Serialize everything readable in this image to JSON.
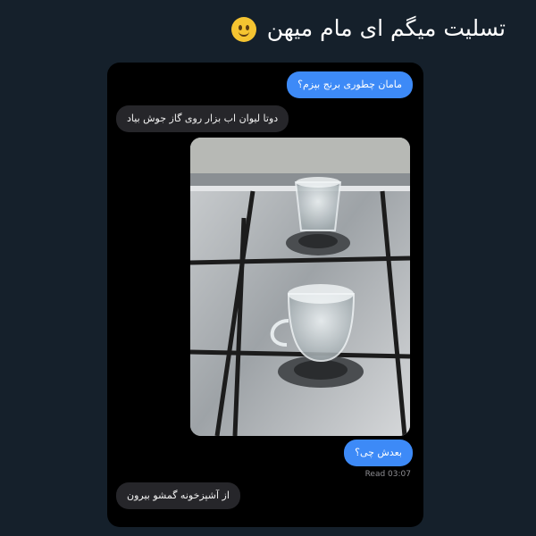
{
  "caption": {
    "text": "تسلیت میگم ای مام میهن",
    "emoji": "slightly-smiling-face-icon"
  },
  "messages": [
    {
      "direction": "outgoing",
      "text": "مامان چطوری برنج بپزم؟"
    },
    {
      "direction": "incoming",
      "text": "دوتا لیوان اب بزار روی گاز جوش بیاد"
    },
    {
      "direction": "incoming",
      "type": "photo",
      "description_icon": "stove-with-glasses-photo"
    },
    {
      "direction": "outgoing",
      "text": "بعدش چی؟"
    },
    {
      "direction": "incoming",
      "text": "از آشپزخونه گمشو بیرون"
    }
  ],
  "receipt": {
    "text": "Read 03:07"
  },
  "colors": {
    "background": "#15202b",
    "chat_bg": "#000000",
    "outgoing": "#3d8af7",
    "incoming": "#26262a"
  }
}
